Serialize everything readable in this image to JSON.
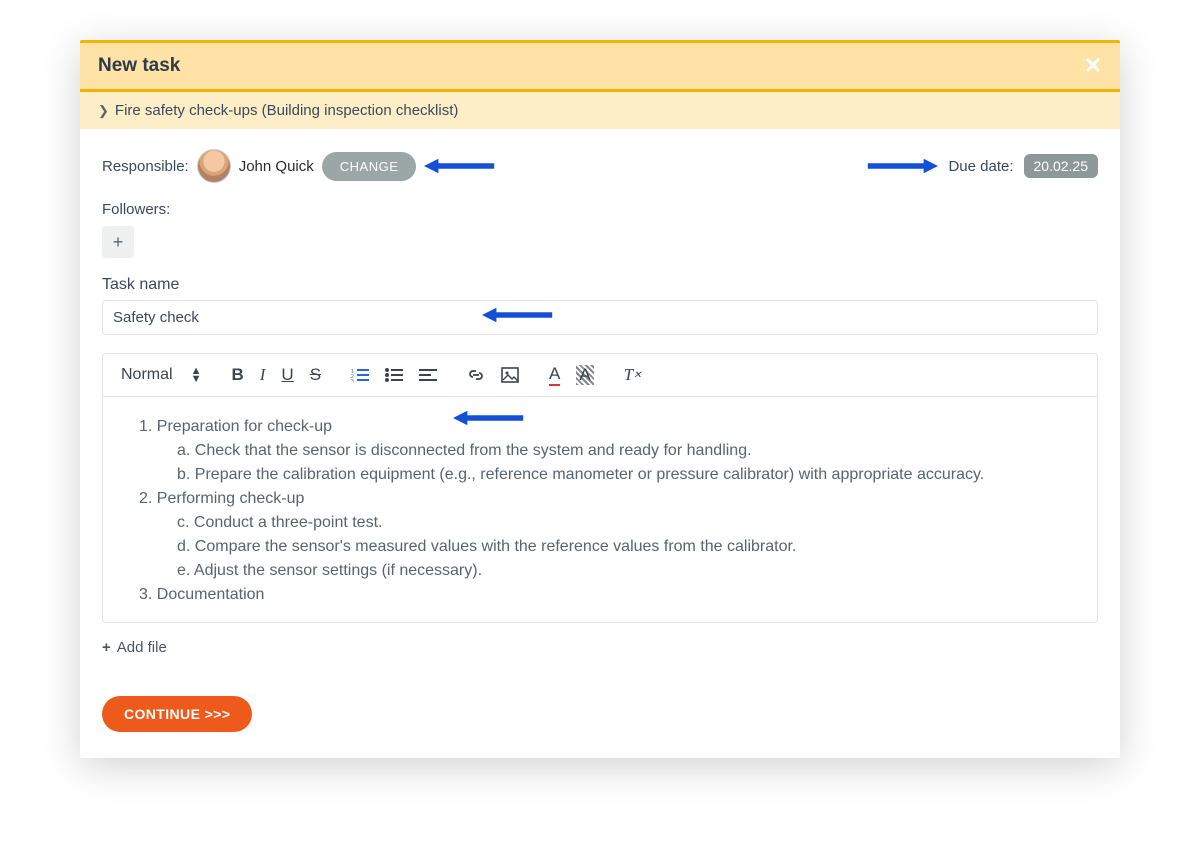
{
  "header": {
    "title": "New task",
    "breadcrumb": "Fire safety check-ups (Building inspection checklist)"
  },
  "responsible": {
    "label": "Responsible:",
    "name": "John Quick",
    "change_label": "CHANGE"
  },
  "due": {
    "label": "Due date:",
    "value": "20.02.25"
  },
  "followers": {
    "label": "Followers:"
  },
  "task_name": {
    "label": "Task name",
    "value": "Safety check"
  },
  "toolbar": {
    "format": "Normal"
  },
  "editor": {
    "items": [
      {
        "num": "1.",
        "text": "Preparation for check-up"
      },
      {
        "letter": "a.",
        "text": "Check that the sensor is disconnected from the system and ready for handling."
      },
      {
        "letter": "b.",
        "text": "Prepare the calibration equipment (e.g., reference manometer or pressure calibrator) with appropriate accuracy."
      },
      {
        "num": "2.",
        "text": "Performing check-up"
      },
      {
        "letter": "c.",
        "text": "Conduct a three-point test."
      },
      {
        "letter": "d.",
        "text": "Compare the sensor's measured values with the reference values from the calibrator."
      },
      {
        "letter": "e.",
        "text": "Adjust the sensor settings (if necessary)."
      },
      {
        "num": "3.",
        "text": "Documentation"
      }
    ]
  },
  "add_file": "Add file",
  "continue": "CONTINUE >>>"
}
